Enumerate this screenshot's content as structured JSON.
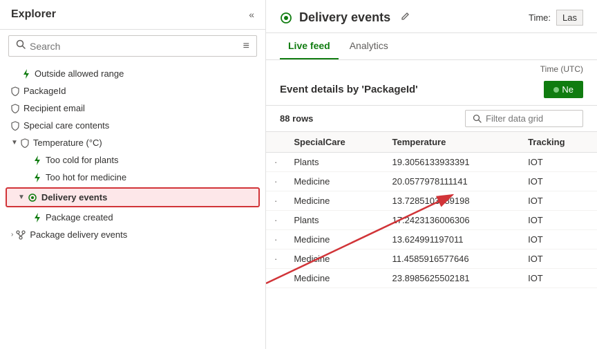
{
  "sidebar": {
    "title": "Explorer",
    "search_placeholder": "Search",
    "items": [
      {
        "id": "outside-allowed-range",
        "label": "Outside allowed range",
        "indent": 2,
        "icon": "bolt",
        "type": "rule"
      },
      {
        "id": "packageid",
        "label": "PackageId",
        "indent": 1,
        "icon": "shield",
        "type": "field"
      },
      {
        "id": "recipient-email",
        "label": "Recipient email",
        "indent": 1,
        "icon": "shield",
        "type": "field"
      },
      {
        "id": "special-care-contents",
        "label": "Special care contents",
        "indent": 1,
        "icon": "shield",
        "type": "field"
      },
      {
        "id": "temperature",
        "label": "Temperature (°C)",
        "indent": 1,
        "icon": "shield",
        "type": "group",
        "expanded": true,
        "chevron": "▼"
      },
      {
        "id": "too-cold-for-plants",
        "label": "Too cold for plants",
        "indent": 2,
        "icon": "bolt",
        "type": "rule"
      },
      {
        "id": "too-hot-for-medicine",
        "label": "Too hot for medicine",
        "indent": 2,
        "icon": "bolt",
        "type": "rule"
      },
      {
        "id": "delivery-events",
        "label": "Delivery events",
        "indent": 0,
        "icon": "radio",
        "type": "group",
        "expanded": true,
        "chevron": "▼",
        "selected": true
      },
      {
        "id": "package-created",
        "label": "Package created",
        "indent": 2,
        "icon": "bolt",
        "type": "rule"
      },
      {
        "id": "package-delivery-events",
        "label": "Package delivery events",
        "indent": 0,
        "icon": "branch",
        "type": "group",
        "chevron": "▼"
      }
    ]
  },
  "main": {
    "title": "Delivery events",
    "time_label": "Time:",
    "time_value": "Las",
    "tabs": [
      {
        "id": "live-feed",
        "label": "Live feed",
        "active": true
      },
      {
        "id": "analytics",
        "label": "Analytics",
        "active": false
      }
    ],
    "time_utc_label": "Time (UTC)",
    "event_details_title": "Event details by 'PackageId'",
    "new_button_label": "Ne",
    "rows_count": "88 rows",
    "filter_placeholder": "Filter data grid",
    "table": {
      "columns": [
        "",
        "SpecialCare",
        "Temperature",
        "Tracking"
      ],
      "rows": [
        {
          "dot": "·",
          "special_care": "Plants",
          "temperature": "19.3056133933391",
          "tracking": "IOT"
        },
        {
          "dot": "·",
          "special_care": "Medicine",
          "temperature": "20.0577978111141",
          "tracking": "IOT"
        },
        {
          "dot": "·",
          "special_care": "Medicine",
          "temperature": "13.7285103789198",
          "tracking": "IOT"
        },
        {
          "dot": "·",
          "special_care": "Plants",
          "temperature": "17.2423136006306",
          "tracking": "IOT"
        },
        {
          "dot": "·",
          "special_care": "Medicine",
          "temperature": "13.624991197011",
          "tracking": "IOT"
        },
        {
          "dot": "·",
          "special_care": "Medicine",
          "temperature": "11.4585916577646",
          "tracking": "IOT"
        },
        {
          "dot": "·",
          "special_care": "Medicine",
          "temperature": "23.8985625502181",
          "tracking": "IOT"
        }
      ]
    }
  },
  "icons": {
    "bolt": "⚡",
    "shield": "🛡",
    "radio": "📡",
    "branch": "⑂",
    "chevron_right": "›",
    "chevron_down": "⌄",
    "edit": "✏",
    "search": "🔍",
    "filter": "≡",
    "collapse": "«"
  }
}
